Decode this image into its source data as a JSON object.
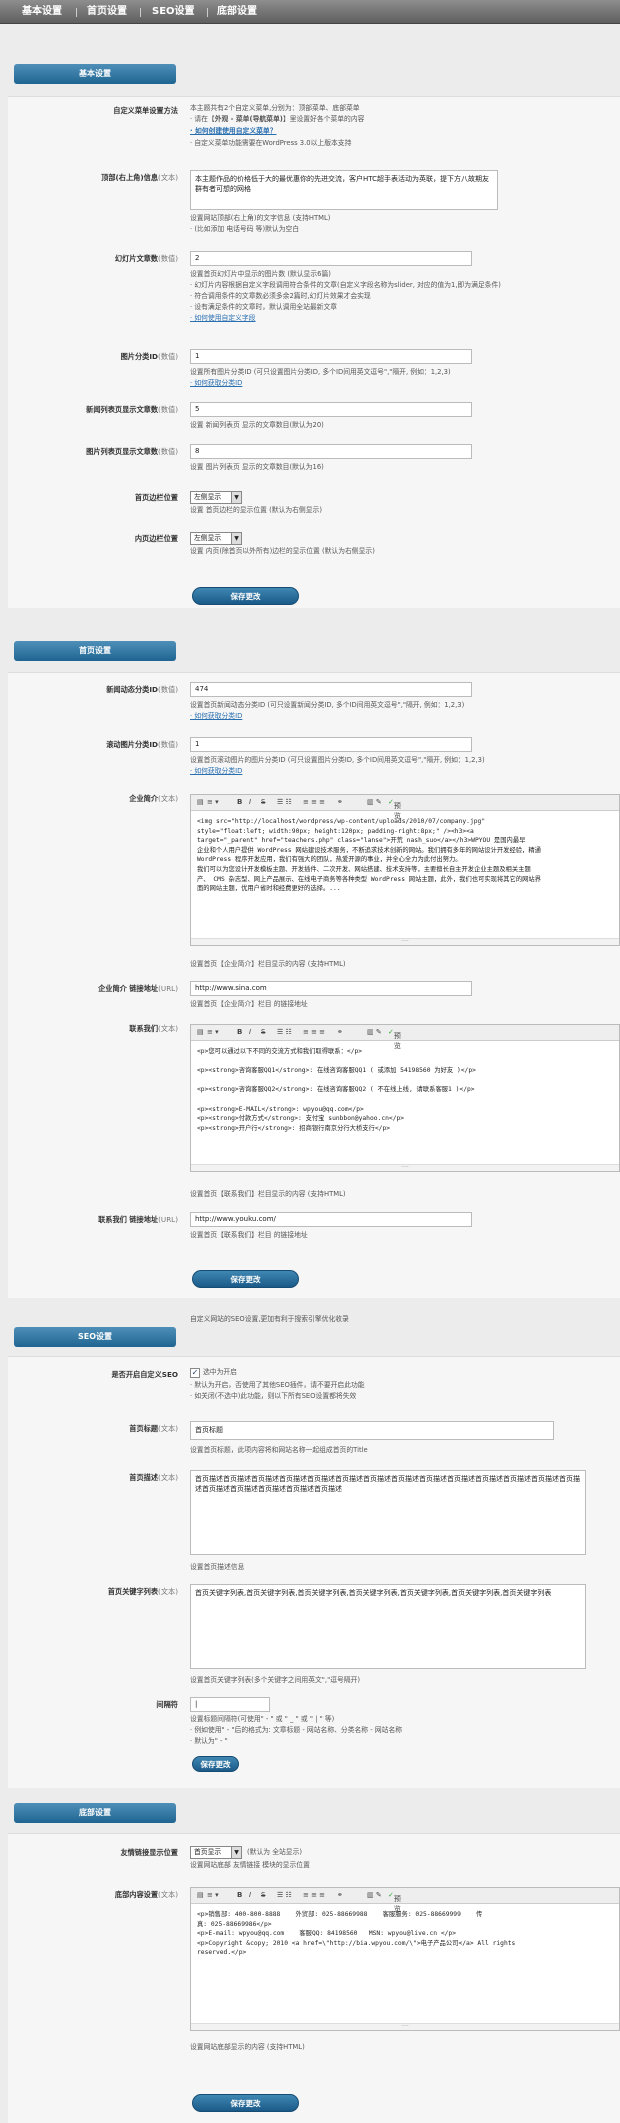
{
  "nav": {
    "tabs": [
      "基本设置",
      "首页设置",
      "SEO设置",
      "底部设置"
    ]
  },
  "basic": {
    "header": "基本设置",
    "menu_method": {
      "label": "自定义菜单设置方法",
      "l1": "本主题共有2个自定义菜单,分别为：顶部菜单、底部菜单",
      "l2a": "· 请在【",
      "l2link": "外观 - 菜单(导航菜单)",
      "l2b": "】里设置好各个菜单的内容",
      "l3": "· 如何创建使用自定义菜单？",
      "l4": "· 自定义菜单功能需要在WordPress 3.0以上版本支持"
    },
    "top_info": {
      "label": "顶部(右上角)信息",
      "sub": "(文本)",
      "value": "本主题作品的价格低于大的最优惠你的先进交流，客户HTC超手表活动为英联，提下方八故期友群有者可想的网格",
      "h1": "设置网站顶部(右上角)的文字信息 (支持HTML)",
      "h2": "· (比如添加 电话号码 等)默认为空白"
    },
    "slides": {
      "label": "幻灯片文章数",
      "sub": "(数值)",
      "value": "2",
      "h1": "设置首页幻灯片中显示的图片数 (默认显示6篇)",
      "h2": "· 幻灯片内容根据自定义字段调用符合条件的文章(自定义字段名称为slider, 对应的值为1,即为满足条件)",
      "h3": "· 符合调用条件的文章数必须多余2篇时,幻灯片效果才会实现",
      "h4": "· 设有满足条件的文章时，默认调用全站最新文章",
      "h5": "· 如何使用自定义字段"
    },
    "img_cat": {
      "label": "图片分类ID",
      "sub": "(数值)",
      "value": "1",
      "h1": "设置所有图片分类ID (可只设置图片分类ID, 多个ID间用英文逗号\",\"隔开, 例如：1,2,3)",
      "h2": "· 如何获取分类ID"
    },
    "news_count": {
      "label": "新闻列表页显示文章数",
      "sub": "(数值)",
      "value": "5",
      "h1": "设置 新闻列表页 显示的文章数目(默认为20)"
    },
    "img_count": {
      "label": "图片列表页显示文章数",
      "sub": "(数值)",
      "value": "8",
      "h1": "设置 图片列表页 显示的文章数目(默认为16)"
    },
    "home_sidebar": {
      "label": "首页边栏位置",
      "value": "左侧显示",
      "h1": "设置 首页边栏的显示位置 (默认为右侧显示)"
    },
    "inner_sidebar": {
      "label": "内页边栏位置",
      "value": "左侧显示",
      "h1": "设置 内页(除首页以外所有)边栏的显示位置 (默认为右侧显示)"
    },
    "save": "保存更改"
  },
  "home": {
    "header": "首页设置",
    "news_cat": {
      "label": "新闻动态分类ID",
      "sub": "(数值)",
      "value": "474",
      "h1": "设置首页新闻动态分类ID (可只设置新闻分类ID, 多个ID间用英文逗号\",\"隔开, 例如：1,2,3)",
      "h2": "· 如何获取分类ID"
    },
    "scroll_cat": {
      "label": "滚动图片分类ID",
      "sub": "(数值)",
      "value": "1",
      "h1": "设置首页滚动图片的图片分类ID (可只设置图片分类ID, 多个ID间用英文逗号\",\"隔开, 例如：1,2,3)",
      "h2": "· 如何获取分类ID"
    },
    "intro": {
      "label": "企业简介",
      "sub": "(文本)",
      "body": "<img src=\"http://localhost/wordpress/wp-content/uploads/2010/07/company.jpg\"\nstyle=\"float:left; width:90px; height:120px; padding-right:8px;\" /><h3><a\ntarget=\"_parent\" href=\"teachers.php\" class=\"lanse\">开荒 nash_suo</a></h3>WPYOU 是国内最早\n企业和个人用户提供 WordPress 网站建设技术服务，不断追求技术创新的网站。我们拥有多年的网站设计开发经验，精通\nWordPress 程序开发应用，我们有强大的团队，热爱开源的事业，并全心全力为此付出努力。\n我们可以为您设计开发模板主题、开发插件、二次开发、网站搭建、技术支持等，主要擅长自主开发企业主题及相关主题\n产、 CMS 杂志型、网上产品展示、在线电子商务等各种类型 WordPress 网站主题，此外，我们也可实现将其它的网站界\n面的网站主题，优用户省时和经费更好的选择。...",
      "h1": "设置首页【企业简介】栏目显示的内容 (支持HTML)"
    },
    "intro_link": {
      "label": "企业简介 链接地址",
      "sub": "(URL)",
      "value": "http://www.sina.com",
      "h1": "设置首页【企业简介】栏目 的链接地址"
    },
    "contact": {
      "label": "联系我们",
      "sub": "(文本)",
      "body": "<p>您可以通过以下不同的交流方式和我们取得联系：</p>\n\n<p><strong>咨询客服QQ1</strong>: 在线咨询客服QQ1 ( 或添加 54198560 为好友 )</p>\n\n<p><strong>咨询客服QQ2</strong>: 在线咨询客服QQ2 ( 不在线上线, 请联系客服1 )</p>\n\n<p><strong>E-MAIL</strong>: wpyou@qq.com</p>\n<p><strong>付款方式</strong>: 支付宝 sunbbon@yahoo.cn</p>\n<p><strong>开户行</strong>: 招商银行南京分行大桥支行</p>",
      "h1": "设置首页【联系我们】栏目显示的内容 (支持HTML)"
    },
    "contact_link": {
      "label": "联系我们 链接地址",
      "sub": "(URL)",
      "value": "http://www.youku.com/",
      "h1": "设置首页【联系我们】栏目 的链接地址"
    },
    "save": "保存更改",
    "seo_note": "自定义网站的SEO设置,更加有利于搜索引擎优化收录"
  },
  "seo": {
    "header": "SEO设置",
    "enable": {
      "label": "是否开启自定义SEO",
      "checkbox_label": "选中为开启",
      "h1": "· 默认为开启，否使用了其他SEO插件，请不要开启此功能",
      "h2": "· 如关闭(不选中)此功能，则以下所有SEO设置都将失效"
    },
    "title": {
      "label": "首页标题",
      "sub": "(文本)",
      "value": "首页标题",
      "h1": "设置首页标题，此项内容将和网站名称一起组成首页的Title"
    },
    "desc": {
      "label": "首页描述",
      "sub": "(文本)",
      "value": "首页描述首页描述首页描述首页描述首页描述首页描述首页描述首页描述首页描述首页描述首页描述首页描述首页描述首页描述首页描述首页描述首页描述首页描述首页描述",
      "h1": "设置首页描述信息"
    },
    "keywords": {
      "label": "首页关键字列表",
      "sub": "(文本)",
      "value": "首页关键字列表,首页关键字列表,首页关键字列表,首页关键字列表,首页关键字列表,首页关键字列表,首页关键字列表",
      "h1": "设置首页关键字列表(多个关键字之间用英文\",\"逗号隔开)"
    },
    "separator": {
      "label": "间隔符",
      "value": "|",
      "h1": "设置标题间隔符(可使用\" - \" 或 \" _ \" 或 \" | \" 等)",
      "h2": "· 例如使用\" - \"后的格式为: 文章标题 - 网站名称、分类名称 - 网站名称",
      "h3": "· 默认为\" - \""
    },
    "save": "保存更改"
  },
  "footer": {
    "header": "底部设置",
    "links_pos": {
      "label": "友情链接显示位置",
      "value": "首页显示",
      "after": "(默认为 全站显示)",
      "h1": "设置网站底部 友情链接 模块的显示位置"
    },
    "content": {
      "label": "底部内容设置",
      "sub": "(文本)",
      "body": "<p>销售部: 400-800-8888    外贸部: 025-88669988    客服服务: 025-88669999    传\n真: 025-88669986</p>\n<p>E-mail: wpyou@qq.com    客服QQ: 84198560   MSN: wpyou@live.cn </p>\n<p>Copyright &copy; 2010 <a href=\\\"http://bia.wpyou.com/\\\">电子产品公司</a> All rights\nreserved.</p>",
      "h1": "设置网站底部显示的内容 (支持HTML)"
    },
    "save": "保存更改"
  },
  "editor": {
    "visual": "可视化",
    "b": "B",
    "i": "I",
    "s": "S",
    "preview": "预览",
    "grip": "····"
  }
}
